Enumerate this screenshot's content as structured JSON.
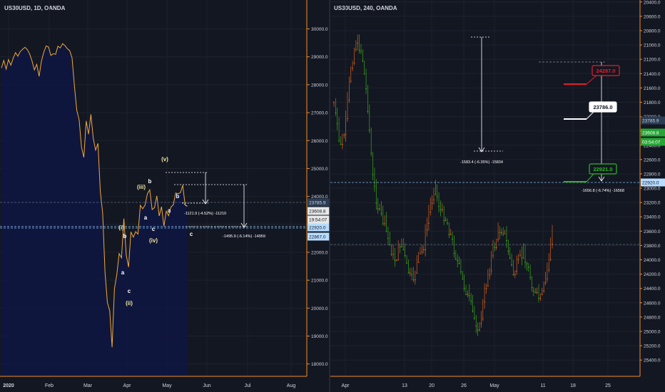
{
  "left_title": "US30USD, 1D, OANDA",
  "right_title": "US30USD, 240, OANDA",
  "chart_data": [
    {
      "type": "line",
      "title": "US30USD, 1D, OANDA",
      "xlabel": "",
      "ylabel": "",
      "x_ticks": [
        "2020",
        "Feb",
        "Mar",
        "Apr",
        "May",
        "Jun",
        "Jul",
        "Aug"
      ],
      "y_ticks": [
        "18000.0",
        "19000.0",
        "20000.0",
        "21000.0",
        "22000.0",
        "23000.0",
        "24000.0",
        "25000.0",
        "26000.0",
        "27000.0",
        "28000.0",
        "29000.0",
        "30000.0"
      ],
      "ylim": [
        17500,
        30600
      ],
      "series": [
        {
          "values": [
            28600,
            28870,
            28560,
            28900,
            28700,
            28950,
            29150,
            29020,
            29190,
            29270,
            29340,
            29260,
            29100,
            28850,
            28530,
            28730,
            28300,
            28850,
            29170,
            29390,
            29350,
            29050,
            29110,
            29090,
            29380,
            29320,
            29470,
            29400,
            29290,
            29220,
            28960,
            27960,
            27080,
            26750,
            25770,
            25400,
            26700,
            26230,
            26940,
            26080,
            25660,
            25900,
            24180,
            23400,
            21280,
            20200,
            19900,
            18600,
            20700,
            21200,
            21950,
            21800,
            23210,
            21900,
            21470,
            22730,
            22540,
            22740,
            22650,
            23680,
            23560,
            23690,
            24100,
            24240,
            23530,
            23600,
            24020,
            23300,
            23630,
            22930,
            23470,
            23310,
            23620,
            23700,
            24120,
            24100,
            24130,
            24400,
            23700,
            23650
          ]
        }
      ],
      "annotations": [
        {
          "text": "(v)"
        },
        {
          "text": "(iii)"
        },
        {
          "text": "b"
        },
        {
          "text": "a"
        },
        {
          "text": "c"
        },
        {
          "text": "(iv)"
        },
        {
          "text": "a"
        },
        {
          "text": "b"
        },
        {
          "text": "c"
        },
        {
          "text": "(i)"
        },
        {
          "text": "b"
        },
        {
          "text": "a"
        },
        {
          "text": "c"
        },
        {
          "text": "(ii)"
        }
      ],
      "measures": [
        {
          "text": "-1121.9 (-4.52%) -11210"
        },
        {
          "text": "-1495.9 (-6.14%) -14959"
        }
      ],
      "price_labels": [
        {
          "value": "23785.9",
          "color": "#2a3d55",
          "text_color": "#d1d4dc"
        },
        {
          "value": "23608.8",
          "color": "#e8e8e8",
          "text_color": "#131722"
        },
        {
          "value": "19:54:07",
          "color": "#e8e8e8",
          "text_color": "#131722"
        },
        {
          "value": "22920.0",
          "color": "#b7dcff",
          "text_color": "#131722"
        },
        {
          "value": "22867.0",
          "color": "#b7dcff",
          "text_color": "#131722"
        }
      ],
      "line_color": "#f0a93a",
      "fill_color": "#0f1640"
    },
    {
      "type": "candlestick",
      "title": "US30USD, 240, OANDA",
      "xlabel": "",
      "ylabel": "",
      "x_ticks": [
        "Apr",
        "13",
        "20",
        "26",
        "May",
        "11",
        "18",
        "25"
      ],
      "y_ticks": [
        "20400.0",
        "20600.0",
        "20800.0",
        "21000.0",
        "21200.0",
        "21400.0",
        "21600.0",
        "21800.0",
        "22000.0",
        "22200.0",
        "22400.0",
        "22600.0",
        "22800.0",
        "23000.0",
        "23200.0",
        "23400.0",
        "23600.0",
        "23800.0",
        "24000.0",
        "24200.0",
        "24400.0",
        "24600.0",
        "24800.0",
        "25000.0",
        "25200.0",
        "25400.0"
      ],
      "ylim": [
        20250,
        25500
      ],
      "close_path": [
        21800,
        22400,
        22200,
        21300,
        20900,
        21100,
        21800,
        22900,
        23300,
        23500,
        23800,
        24000,
        23700,
        24100,
        24300,
        24000,
        23800,
        23300,
        22950,
        23300,
        23400,
        23700,
        24000,
        24300,
        24500,
        24800,
        24950,
        24400,
        24000,
        23700,
        23500,
        23800,
        24200,
        24000,
        23900,
        24200,
        24500,
        24550,
        24200,
        23600
      ],
      "up_color": "#3aa91a",
      "down_color": "#d8621e",
      "levels": [
        {
          "label": "24287.0",
          "value": 24287,
          "color": "#e0202b"
        },
        {
          "label": "23786.0",
          "value": 23786,
          "color": "#ffffff"
        },
        {
          "label": "22921.0",
          "value": 22921,
          "color": "#2eb52a"
        }
      ],
      "measures": [
        {
          "text": "-1583.4 (-6.35%) -15834"
        },
        {
          "text": "-1656.8 (-6.74%) -16568"
        }
      ],
      "price_labels": [
        {
          "value": "23785.9",
          "color": "#2a3d55",
          "text_color": "#d1d4dc"
        },
        {
          "value": "23608.8",
          "color": "#26a534",
          "text_color": "#ffffff"
        },
        {
          "value": "03:54:07",
          "color": "#26a534",
          "text_color": "#ffffff"
        },
        {
          "value": "22920.0",
          "color": "#b7dcff",
          "text_color": "#131722"
        }
      ]
    }
  ]
}
